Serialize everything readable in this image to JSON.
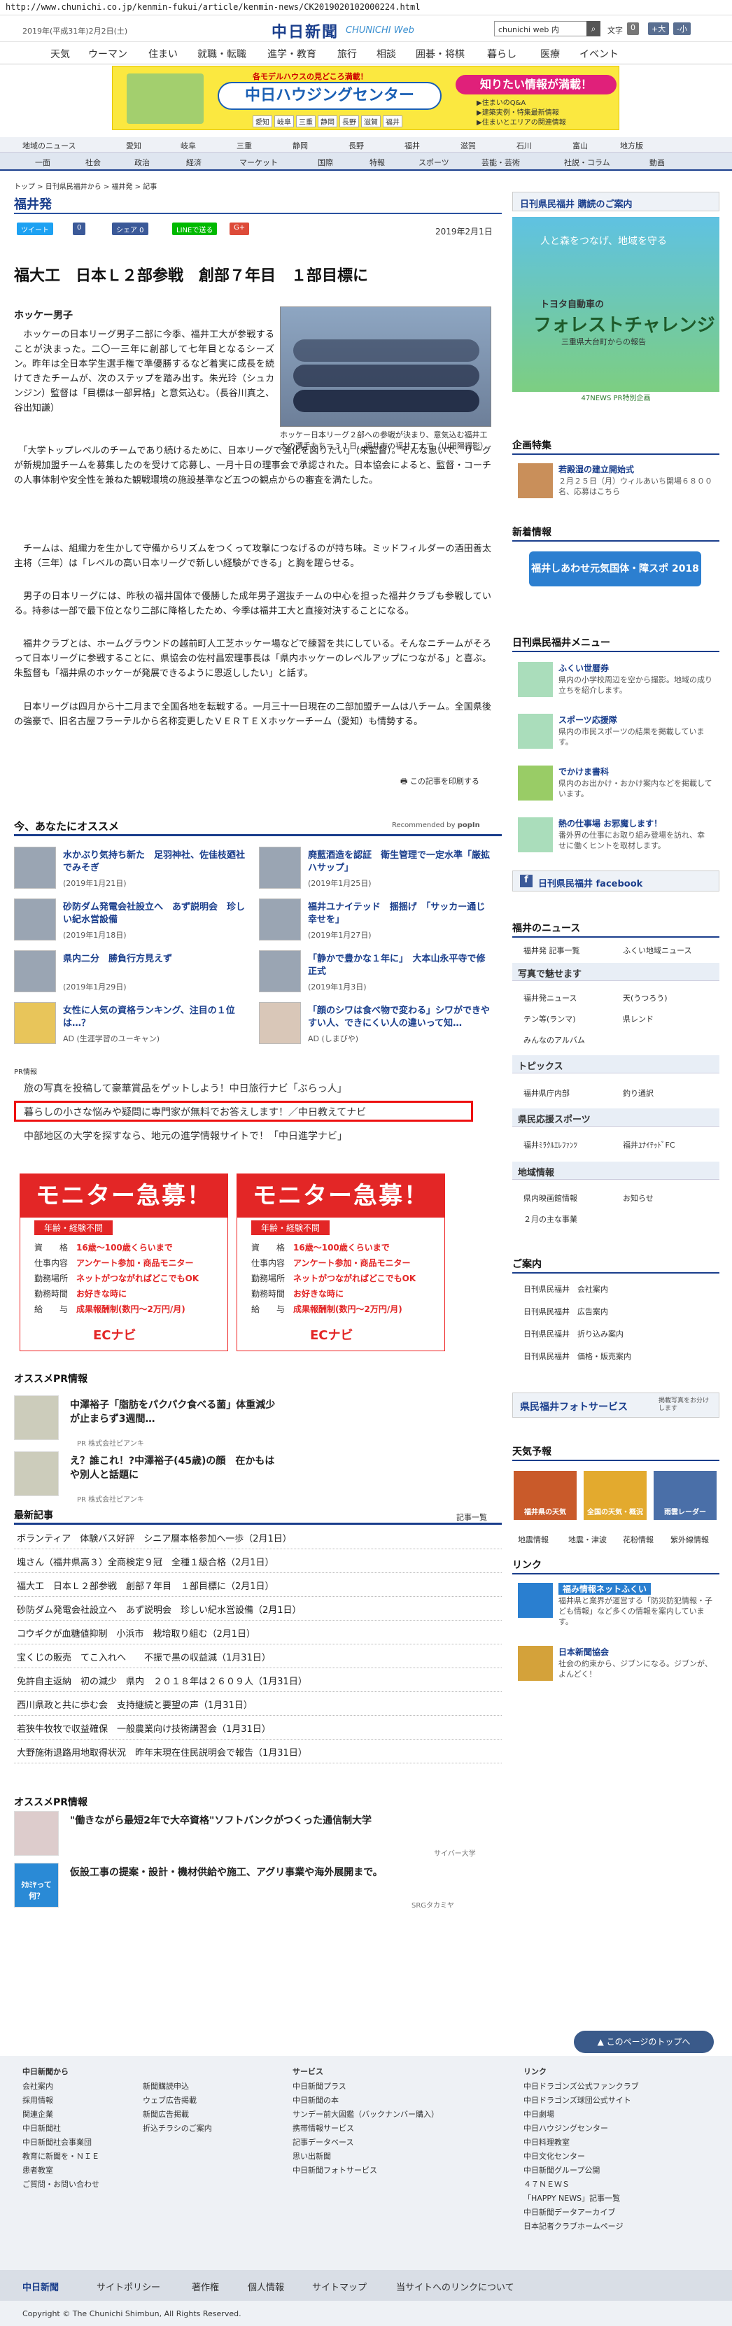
{
  "url": "http://www.chunichi.co.jp/kenmin-fukui/article/kenmin-news/CK2019020102000224.html",
  "header": {
    "date": "2019年(平成31年)2月2日(土)",
    "logo": "中日新聞",
    "logo_web": "CHUNICHI Web",
    "search_value": "chunichi web 内",
    "font_label": "文字",
    "font_reset": "0",
    "font_up": "+大",
    "font_down": "-小"
  },
  "nav_main": [
    "天気",
    "ウーマン",
    "住まい",
    "就職・転職",
    "進学・教育",
    "旅行",
    "相談",
    "囲碁・将棋",
    "暮らし",
    "医療",
    "イベント"
  ],
  "banner": {
    "pre": "各モデルハウスの見どころ満載！",
    "title": "中日ハウジングセンター",
    "bubble": "知りたい情報が満載！",
    "sub1": "▶住まいのQ&A",
    "sub2": "▶建築実例・特集最新情報",
    "sub3": "▶住まいとエリアの関連情報",
    "tags": [
      "愛知",
      "岐阜",
      "三重",
      "静岡",
      "長野",
      "滋賀",
      "福井"
    ]
  },
  "nav_region": [
    "地域のニュース",
    "愛知",
    "岐阜",
    "三重",
    "静岡",
    "長野",
    "福井",
    "滋賀",
    "石川",
    "富山",
    "地方版"
  ],
  "nav_cat": [
    "一面",
    "社会",
    "政治",
    "経済",
    "マーケット",
    "国際",
    "特報",
    "スポーツ",
    "芸能・芸術",
    "社説・コラム",
    "動画"
  ],
  "breadcrumb": "トップ > 日刊県民福井から > 福井発 > 記事",
  "section": "福井発",
  "share": {
    "tweet": "ツイート",
    "like": "0",
    "share": "シェア 0",
    "line": "LINEで送る",
    "gplus": "G+"
  },
  "article": {
    "date": "2019年2月1日",
    "title": "福大工　日本Ｌ２部参戦　創部７年目　１部目標に",
    "subhead": "ホッケー男子",
    "caption": "ホッケー日本リーグ２部への参戦が決まり、意気込む福井工大の選手たち＝３１日、福井市の福井工大で（山田陽撮影）",
    "p1": "　ホッケーの日本リーグ男子二部に今季、福井工大が参戦することが決まった。二〇一三年に創部して七年目となるシーズン。昨年は全日本学生選手権で準優勝するなど着実に成長を続けてきたチームが、次のステップを踏み出す。朱光玲（シュカンジン）監督は「目標は一部昇格」と意気込む。（長谷川真之、谷出知謙）",
    "p2": "　「大学トップレベルのチームであり続けるために、日本リーグで強化を図りたい」（朱監督）。そんな思いで、リーグが新規加盟チームを募集したのを受けて応募し、一月十日の理事会で承認された。日本協会によると、監督・コーチの人事体制や安全性を兼ねた観戦環境の施設基準など五つの観点からの審査を満たした。",
    "p3": "　チームは、組織力を生かして守備からリズムをつくって攻撃につなげるのが持ち味。ミッドフィルダーの酒田善太主将（三年）は「レベルの高い日本リーグで新しい経験ができる」と胸を躍らせる。",
    "p4": "　男子の日本リーグには、昨秋の福井国体で優勝した成年男子選抜チームの中心を担った福井クラブも参戦している。持参は一部で最下位となり二部に降格したため、今季は福井工大と直接対決することになる。",
    "p5": "　福井クラブとは、ホームグラウンドの越前町人工芝ホッケー場などで練習を共にしている。そんなニチームがそろって日本リーグに参戦することに、県協会の佐村昌宏理事長は「県内ホッケーのレベルアップにつながる」と喜ぶ。朱監督も「福井県のホッケーが発展できるように恩返ししたい」と話す。",
    "p6": "　日本リーグは四月から十二月まで全国各地を転戦する。一月三十一日現在の二部加盟チームは八チーム。全国県後の強豪で、旧名古屋フラーテルから名称変更したＶＥＲＴＥＸホッケーチーム（愛知）も情勢する。",
    "print": "この記事を印刷する"
  },
  "reco": {
    "title": "今、あなたにオススメ",
    "by": "Recommended by",
    "brand": "popIn",
    "items": [
      {
        "title": "水かぶり気持ち新た　足羽神社、佐佳枝廼社でみそぎ",
        "date": "(2019年1月21日)"
      },
      {
        "title": "廃藍酒造を認証　衛生管理で一定水準「厳拡ハサップ」",
        "date": "(2019年1月25日)"
      },
      {
        "title": "砂防ダム発電会社設立へ　あず説明会　珍しい紀水営設備",
        "date": "(2019年1月18日)"
      },
      {
        "title": "福井ユナイテッド　揺揺げ　「サッカー通じ幸せを」",
        "date": "(2019年1月27日)"
      },
      {
        "title": "県内二分　勝負行方見えず",
        "date": "(2019年1月29日)"
      },
      {
        "title": "「静かで豊かな１年に」　大本山永平寺で修正式",
        "date": "(2019年1月3日)"
      },
      {
        "title": "女性に人気の資格ランキング、注目の１位は…？",
        "date": "AD (生涯学習のユーキャン)"
      },
      {
        "title": "「顔のシワは食べ物で変わる」シワができやすい人、できにくい人の違いって知…",
        "date": "AD (しまびや)"
      }
    ]
  },
  "pr": {
    "label": "PR情報",
    "links": [
      "旅の写真を投稿して豪華賞品をゲットしよう！中日旅行ナビ「ぶらっ人」",
      "暮らしの小さな悩みや疑問に専門家が無料でお答えします！／中日教えてナビ",
      "中部地区の大学を探すなら、地元の進学情報サイトで！「中日進学ナビ」"
    ]
  },
  "monitor": {
    "head": "モニター急募！",
    "pill": "年齢・経験不問",
    "lines": [
      {
        "k": "資　　格",
        "v": "16歳～100歳くらいまで"
      },
      {
        "k": "仕事内容",
        "v": "アンケート参加・商品モニター"
      },
      {
        "k": "勤務場所",
        "v": "ネットがつながればどこでもOK"
      },
      {
        "k": "勤務時間",
        "v": "お好きな時に"
      },
      {
        "k": "給　　与",
        "v": "成果報酬制(数円～2万円/月)"
      }
    ],
    "logo": "ECナビ"
  },
  "osusume_pr": {
    "title": "オススメPR情報",
    "items": [
      {
        "title": "中澤裕子「脂肪をパクパク食べる菌」体重減少が止まらず3週間…",
        "sponsor": "PR 株式会社ピアンキ"
      },
      {
        "title": "え？誰これ！?中澤裕子(45歳)の顔　在かもはや別人と話題に",
        "sponsor": "PR 株式会社ピアンキ"
      }
    ]
  },
  "latest": {
    "title": "最新記事",
    "more": "記事一覧",
    "items": [
      "ボランティア　体験バス好評　シニア層本格参加へ一歩（2月1日）",
      "塊さん（福井県高３）全商検定９冠　全種１級合格（2月1日）",
      "福大工　日本Ｌ２部参戦　創部７年目　１部目標に（2月1日）",
      "砂防ダム発電会社設立へ　あず説明会　珍しい紀水営設備（2月1日）",
      "コウギクが血糖値抑制　小浜市　栽培取り組む（2月1日）",
      "宝くじの販売　てこ入れへ　　不振で黒の収益減（1月31日）",
      "免許自主返納　初の減少　県内　２０１８年は２６０９人（1月31日）",
      "西川県政と共に歩む会　支持継続と要望の声（1月31日）",
      "若狭牛牧牧で収益確保　一般農業向け技術講習会（1月31日）",
      "大野施術退路用地取得状況　昨年末現在住民説明会で報告（1月31日）"
    ]
  },
  "osusume_pr2": {
    "title": "オススメPR情報",
    "items": [
      {
        "title": "\"働きながら最短2年で大卒資格\"ソフトバンクがつくった通信制大学",
        "sponsor": "サイバー大学"
      },
      {
        "title": "仮設工事の提案・設計・機材供給や施工、アグリ事業や海外展開まで。",
        "sponsor": "SRGタカミヤ"
      }
    ],
    "thumb2": "ﾀｶﾐﾔって何？"
  },
  "right": {
    "paper": "日刊県民福井 購読のご案内",
    "forest_t1": "人と森をつなげ、地域を守る",
    "forest_t2": "トヨタ自動車の",
    "forest_t3": "フォレストチャレンジ",
    "forest_t4": "三重県大台町からの報告",
    "forest_b": "47NEWS PR特別企画",
    "kikaku": "企画特集",
    "kikaku_title": "若殿湿の建立開始式",
    "kikaku_desc": "２月２５日（月）ウィルあいち開場６８００名、応募はこちら",
    "kankan": "新着情報",
    "kankan_banner": "福井しあわせ元気国体・障スポ 2018",
    "menu_title": "日刊県民福井メニュー",
    "menu": [
      {
        "t": "ふくい世暦券",
        "d": "県内の小学校周辺を空から撮影。地域の成り立ちを紹介します。"
      },
      {
        "t": "スポーツ応援隊",
        "d": "県内の市民スポーツの結果を掲載しています。"
      },
      {
        "t": "でかけま書科",
        "d": "県内のお出かけ・おかけ案内などを掲載しています。"
      },
      {
        "t": "熱の仕事場 お邪魔します！",
        "d": "番外界の仕事にお取り組み登場を訪れ、幸せに働くヒントを取材します。"
      }
    ],
    "fb": "日刊県民福井 facebook",
    "fukui_news": "福井のニュース",
    "fukui_links": [
      "福井発 記事一覧",
      "ふくい地域ニュース",
      "写真で魅せます",
      "福井発ニュース",
      "天(うつろう)",
      "テン等(ランマ)",
      "県レンド",
      "みんなのアルバム"
    ],
    "topics": "トピックス",
    "topics_links": [
      "福井県庁内部",
      "釣り通訳"
    ],
    "sports": "県民応援スポーツ",
    "sports_links": [
      "福井ﾐﾗｸﾙｴﾚﾌｧﾝﾂ",
      "福井ﾕﾅｲﾃｯﾄﾞFC"
    ],
    "region": "地域情報",
    "region_links": [
      "県内映画館情報",
      "お知らせ",
      "２月の主な事業"
    ],
    "guide": "ご案内",
    "guide_links": [
      "日刊県民福井　会社案内",
      "日刊県民福井　広告案内",
      "日刊県民福井　折り込み案内",
      "日刊県民福井　価格・販売案内"
    ],
    "photo_service": "県民福井フォトサービス",
    "photo_service_sub": "掲載写真をお分けします",
    "weather": "天気予報",
    "weather_tiles": [
      "福井県の天気",
      "全国の天気・概況",
      "雨雲レーダー"
    ],
    "weather_links": [
      "地震情報",
      "地震・津波",
      "花粉情報",
      "紫外線情報"
    ],
    "link_title": "リンク",
    "link1_t": "福み情報ネットふくい",
    "link1_d": "福井県と業界が運営する「防災防犯情報・子ども情報」など多くの情報を案内しています。",
    "link2_t": "日本新聞協会",
    "link2_d": "社会の約束から、ジブンになる。ジブンが、よんどく！"
  },
  "backtop": "このページのトップへ",
  "footer": {
    "col1_head": "中日新聞から",
    "col1": [
      "会社案内",
      "採用情報",
      "関連企業",
      "中日新聞社",
      "中日新聞社会事業団",
      "教育に新聞を・ＮＩＥ",
      "患者教室",
      "ご質問・お問い合わせ"
    ],
    "col2": [
      "新聞購読申込",
      "ウェブ広告掲載",
      "新聞広告掲載",
      "折込チラシのご案内"
    ],
    "col3_head": "サービス",
    "col3": [
      "中日新聞プラス",
      "中日新聞の本",
      "サンデー前大図鑑（バックナンバー購入）",
      "携帯情報サービス",
      "記事データベース",
      "思い出新聞",
      "中日新聞フォトサービス"
    ],
    "col4_head": "リンク",
    "col4": [
      "中日ドラゴンズ公式ファンクラブ",
      "中日ドラゴンズ球団公式サイト",
      "中日劇場",
      "中日ハウジングセンター",
      "中日料理教室",
      "中日文化センター",
      "中日新聞グループ公開",
      "４７ＮＥＷＳ",
      "「HAPPY NEWS」記事一覧",
      "中日新聞データアーカイブ",
      "日本記者クラブホームページ"
    ],
    "bar": [
      "中日新聞",
      "サイトポリシー",
      "著作権",
      "個人情報",
      "サイトマップ",
      "当サイトへのリンクについて"
    ],
    "copyright": "Copyright © The Chunichi Shimbun, All Rights Reserved."
  }
}
